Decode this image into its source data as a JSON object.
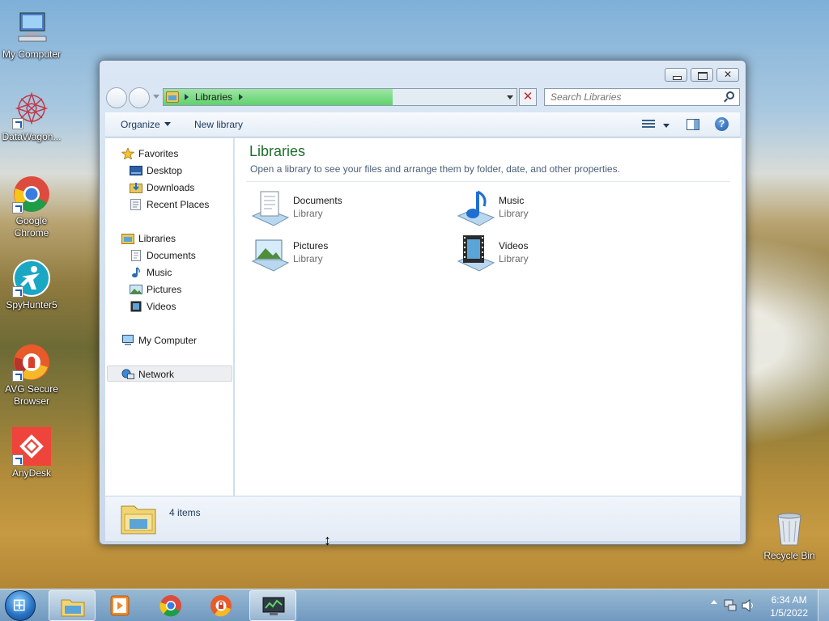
{
  "desktop": {
    "icons": [
      {
        "label": "My Computer"
      },
      {
        "label": "DataWagon..."
      },
      {
        "label": "Google Chrome"
      },
      {
        "label": "SpyHunter5"
      },
      {
        "label": "AVG Secure Browser"
      },
      {
        "label": "AnyDesk"
      },
      {
        "label": "Recycle Bin"
      }
    ]
  },
  "window": {
    "address": {
      "crumb": "Libraries",
      "progress_fraction": 0.65
    },
    "search": {
      "placeholder": "Search Libraries"
    },
    "toolbar": {
      "organize_label": "Organize",
      "new_library_label": "New library"
    },
    "navpane": {
      "favorites": {
        "label": "Favorites",
        "items": [
          "Desktop",
          "Downloads",
          "Recent Places"
        ]
      },
      "libraries": {
        "label": "Libraries",
        "items": [
          "Documents",
          "Music",
          "Pictures",
          "Videos"
        ]
      },
      "computer_label": "My Computer",
      "network_label": "Network"
    },
    "content": {
      "title": "Libraries",
      "subtitle": "Open a library to see your files and arrange them by folder, date, and other properties.",
      "tiles": [
        {
          "name": "Documents",
          "kind": "Library"
        },
        {
          "name": "Music",
          "kind": "Library"
        },
        {
          "name": "Pictures",
          "kind": "Library"
        },
        {
          "name": "Videos",
          "kind": "Library"
        }
      ]
    },
    "details": {
      "count": "4 items"
    }
  },
  "taskbar": {
    "clock_time": "6:34 AM",
    "clock_date": "1/5/2022"
  },
  "colors": {
    "title_green": "#1e6e2c",
    "progress_green": "#5fd26c",
    "link_blue": "#1e395b"
  }
}
